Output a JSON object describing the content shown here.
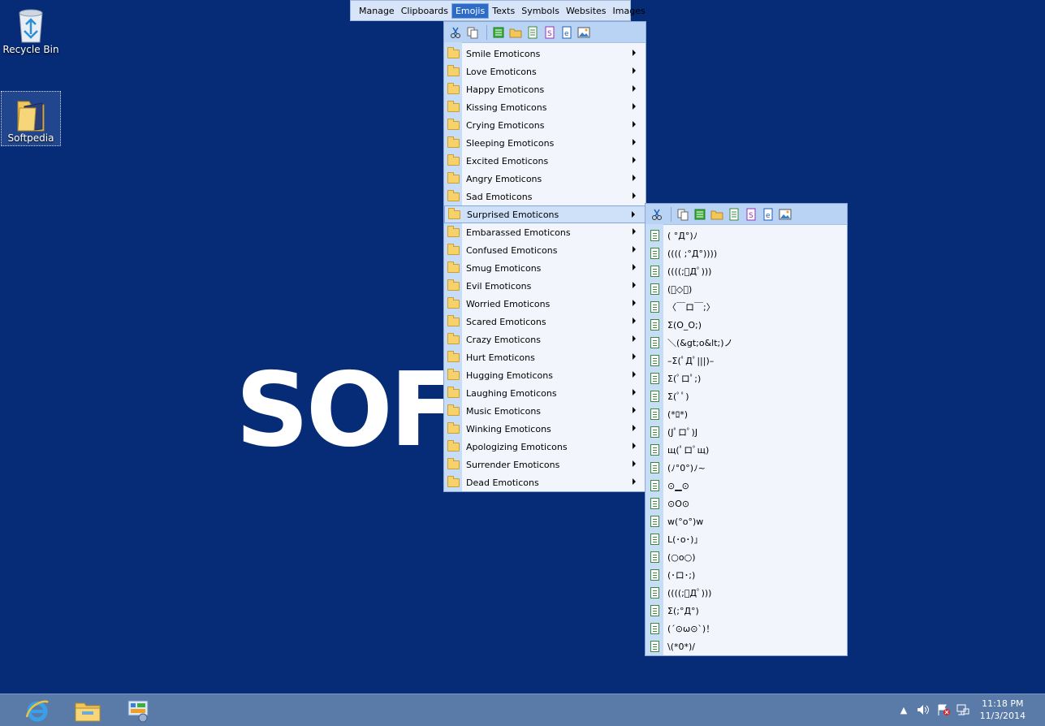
{
  "desktop": {
    "icons": [
      {
        "label": "Recycle Bin"
      },
      {
        "label": "Softpedia"
      }
    ],
    "watermark": "SOFT"
  },
  "menubar": {
    "items": [
      "Manage",
      "Clipboards",
      "Emojis",
      "Texts",
      "Symbols",
      "Websites",
      "Images"
    ],
    "active": "Emojis"
  },
  "emojis_menu": {
    "items": [
      "Smile Emoticons",
      "Love Emoticons",
      "Happy Emoticons",
      "Kissing Emoticons",
      "Crying Emoticons",
      "Sleeping Emoticons",
      "Excited Emoticons",
      "Angry Emoticons",
      "Sad Emoticons",
      "Surprised Emoticons",
      "Embarassed Emoticons",
      "Confused Emoticons",
      "Smug Emoticons",
      "Evil Emoticons",
      "Worried Emoticons",
      "Scared Emoticons",
      "Crazy Emoticons",
      "Hurt Emoticons",
      "Hugging Emoticons",
      "Laughing Emoticons",
      "Music Emoticons",
      "Winking Emoticons",
      "Apologizing Emoticons",
      "Surrender Emoticons",
      "Dead Emoticons"
    ],
    "highlighted": "Surprised Emoticons"
  },
  "surprised_menu": {
    "items": [
      "( °Д°)ﾉ",
      "(((( ;°Д°))))",
      "((((;ﾟДﾟ)))",
      "(ﾟ◇ﾟ)",
      "〈￣ロ￣;〉",
      "Σ(O_O;)",
      "＼(&gt;o&lt;)ノ",
      "–Σ(ﾟДﾟ|||)–",
      "Σ(ﾟロﾟ;)",
      "Σ(ﾟﾟ)",
      "(*ﾛ*)",
      "(Jﾟロﾟ)J",
      "щ(ﾟロﾟщ)",
      "(ﾉ°0°)ﾉ~",
      "⊙▁⊙",
      "⊙O⊙",
      "w(°o°)w",
      "L(･o･)」",
      "(○o○)",
      "(･ロ･;)",
      "((((;ﾟДﾟ)))",
      "Σ(;°Д°)",
      "(´⊙ω⊙`)！",
      "\\(*0*)/"
    ]
  },
  "taskbar": {
    "clock_time": "11:18 PM",
    "clock_date": "11/3/2014"
  }
}
